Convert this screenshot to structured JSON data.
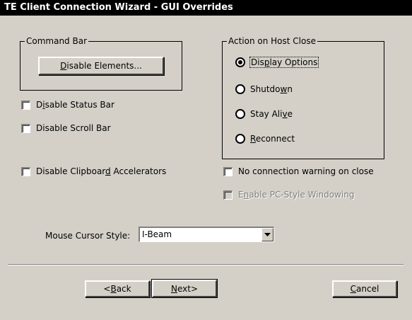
{
  "window": {
    "title": "TE Client Connection Wizard - GUI Overrides"
  },
  "command_bar": {
    "label": "Command Bar",
    "disable_elements": {
      "pre": "",
      "ul": "D",
      "post": "isable Elements..."
    }
  },
  "checkboxes": {
    "status_bar": {
      "pre": "D",
      "ul": "i",
      "post": "sable Status Bar"
    },
    "scroll_bar": {
      "pre": "Disable Scroll Bar",
      "ul": "",
      "post": ""
    },
    "clipboard": {
      "pre": "Disable Clipboar",
      "ul": "d",
      "post": " Accelerators"
    },
    "no_conn_warning": {
      "pre": "No connection warning on close",
      "ul": "",
      "post": ""
    },
    "pc_windowing": {
      "pre": "E",
      "ul": "n",
      "post": "able PC-Style Windowing"
    }
  },
  "action_on_host_close": {
    "label": "Action on Host Close",
    "selected": "display_options",
    "options": {
      "display_options": {
        "pre": "Dis",
        "ul": "p",
        "post": "lay Options"
      },
      "shutdown": {
        "pre": "Shutdo",
        "ul": "w",
        "post": "n"
      },
      "stay_alive": {
        "pre": "Stay Ali",
        "ul": "v",
        "post": "e"
      },
      "reconnect": {
        "pre": "",
        "ul": "R",
        "post": "econnect"
      }
    }
  },
  "mouse_cursor": {
    "label": "Mouse Cursor Style:",
    "value": "I-Beam"
  },
  "buttons": {
    "back": {
      "pre": "<",
      "ul": "B",
      "post": "ack"
    },
    "next": {
      "pre": "",
      "ul": "N",
      "post": "ext>"
    },
    "cancel": {
      "pre": "",
      "ul": "C",
      "post": "ancel"
    }
  },
  "colors": {
    "face": "#d4d0c8",
    "titlebar": "#000000"
  }
}
